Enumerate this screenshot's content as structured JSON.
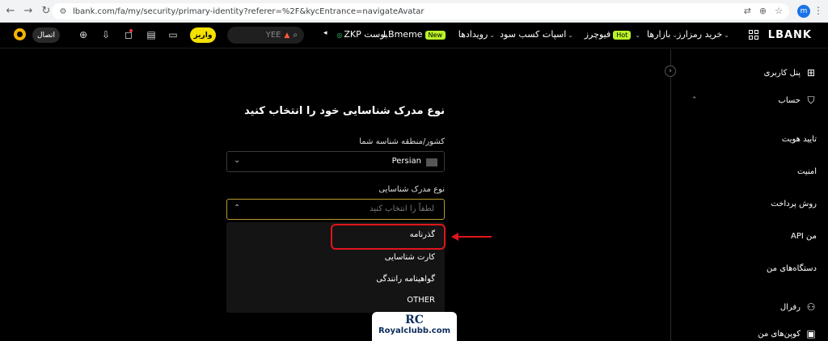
{
  "browser": {
    "url": "lbank.com/fa/my/security/primary-identity?referer=%2F&kycEntrance=navigateAvatar",
    "profile_initial": "m"
  },
  "header": {
    "logo": "LBANK",
    "nav": [
      {
        "label": "خرید رمزارز"
      },
      {
        "label": "بازارها"
      },
      {
        "label": "فیوچرز",
        "badge": "Hot"
      },
      {
        "label": "اسپات"
      },
      {
        "label": "کسب سود"
      },
      {
        "label": "رویدادها"
      }
    ],
    "promo": {
      "label": "LBmeme",
      "badge": "New"
    },
    "promo2": "ZKP بوست",
    "search_text": "YEE",
    "deposit_label": "واریز",
    "connect_label": "اتصال"
  },
  "sidebar": {
    "items": [
      {
        "label": "پنل کاربری",
        "icon": "dashboard-icon"
      },
      {
        "label": "حساب",
        "icon": "shield-icon"
      },
      {
        "label": "تایید هویت"
      },
      {
        "label": "امنیت"
      },
      {
        "label": "روش پرداخت"
      },
      {
        "label": "API من"
      },
      {
        "label": "دستگاه‌های من"
      },
      {
        "label": "رفرال",
        "icon": "users-icon"
      },
      {
        "label": "کوپن‌های من",
        "icon": "ticket-icon"
      }
    ]
  },
  "main": {
    "title": "نوع مدرک شناسایی خود را انتخاب کنید",
    "country_label": "کشور/منطقه شناسه شما",
    "country_value": "Persian",
    "doc_type_label": "نوع مدرک شناسایی",
    "doc_type_placeholder": "لطفاً را انتخاب کنید",
    "options": [
      "گذرنامه",
      "کارت شناسایی",
      "گواهینامه رانندگی",
      "OTHER"
    ]
  },
  "annotation": {
    "color": "#e0151b"
  },
  "watermark": {
    "logo": "RC",
    "text": "Royalclubb.com"
  }
}
